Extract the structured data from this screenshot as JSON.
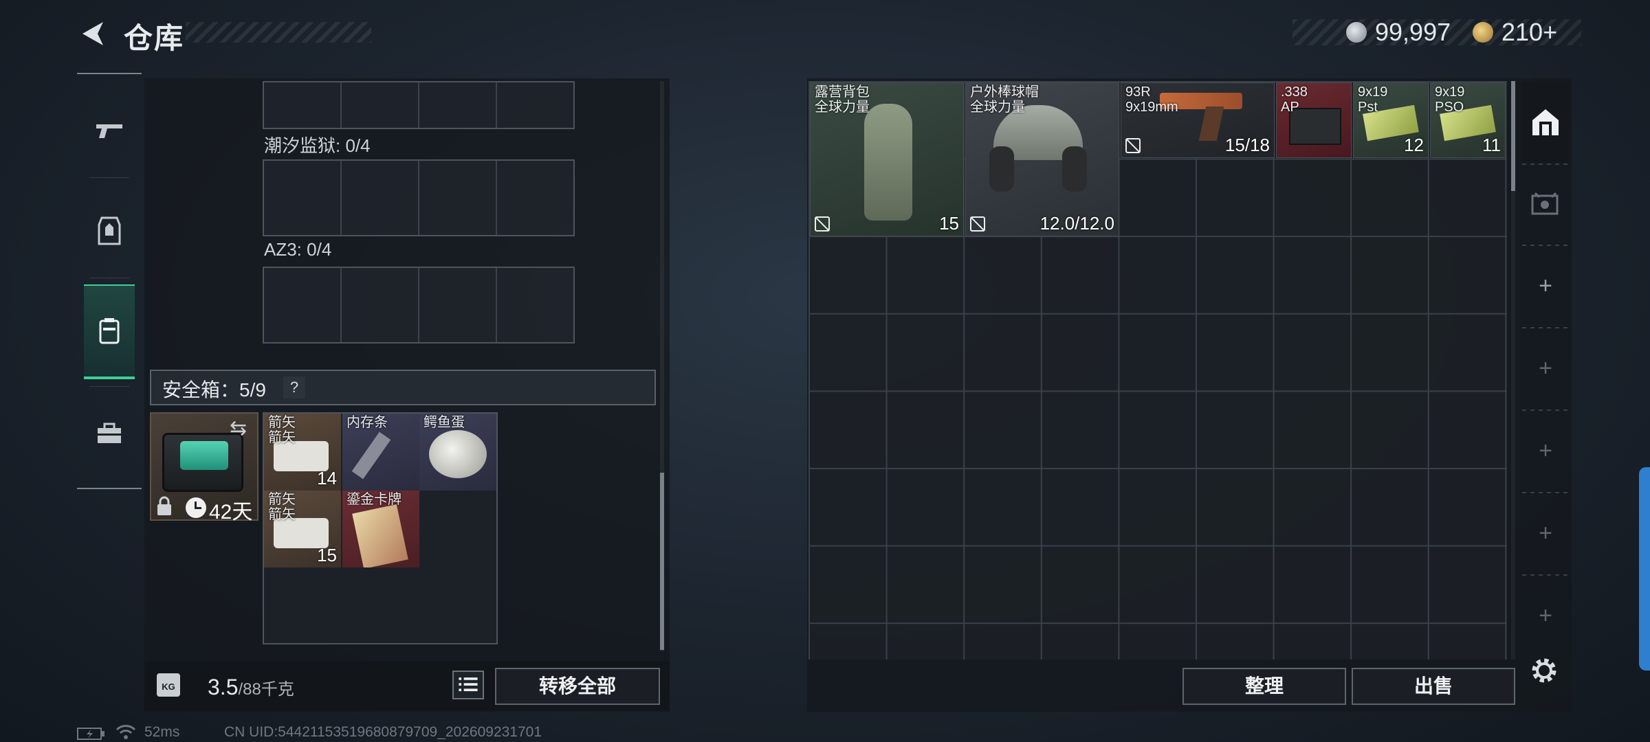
{
  "header": {
    "title": "仓库",
    "currency_silver": "99,997",
    "currency_gold": "210+"
  },
  "nav": {
    "items": [
      "weapons-icon",
      "armor-icon",
      "container-icon",
      "toolbox-icon"
    ],
    "active": "container-icon"
  },
  "containers": [
    {
      "label": "潮汐监狱: 0/4"
    },
    {
      "label": "AZ3: 0/4"
    }
  ],
  "safebox": {
    "label": "安全箱：5/9",
    "help": "?",
    "days": "42天",
    "items": [
      {
        "name": "箭矢\n箭矢",
        "count": "14",
        "rarity": "brown"
      },
      {
        "name": "内存条",
        "count": "",
        "rarity": "purple"
      },
      {
        "name": "鳄鱼蛋",
        "count": "",
        "rarity": "purple"
      },
      {
        "name": "箭矢\n箭矢",
        "count": "15",
        "rarity": "brown"
      },
      {
        "name": "鎏金卡牌",
        "count": "",
        "rarity": "red"
      }
    ]
  },
  "weight": {
    "current": "3.5",
    "max": "/88千克",
    "icon_text": "KG"
  },
  "buttons": {
    "transfer_all": "转移全部",
    "sort": "整理",
    "sell": "出售"
  },
  "stash_items": [
    {
      "name": "露营背包\n全球力量",
      "value": "15",
      "icon": "backpack"
    },
    {
      "name": "户外棒球帽\n全球力量",
      "value": "12.0/12.0",
      "icon": "helmet"
    },
    {
      "name": "93R\n9x19mm",
      "value": "15/18",
      "icon": "pistol"
    },
    {
      "name": ".338\nAP",
      "value": "",
      "icon": "ammo-box"
    },
    {
      "name": "9x19\nPst",
      "value": "12",
      "icon": "ammo-green"
    },
    {
      "name": "9x19\nPSO",
      "value": "11",
      "icon": "ammo-green"
    }
  ],
  "right_tabs": [
    "warehouse-icon",
    "tv-icon",
    "+",
    "+",
    "+",
    "+",
    "+"
  ],
  "status_bar": {
    "ping": "52ms",
    "uid": "CN UID:54421153519680879709_202609231701"
  }
}
